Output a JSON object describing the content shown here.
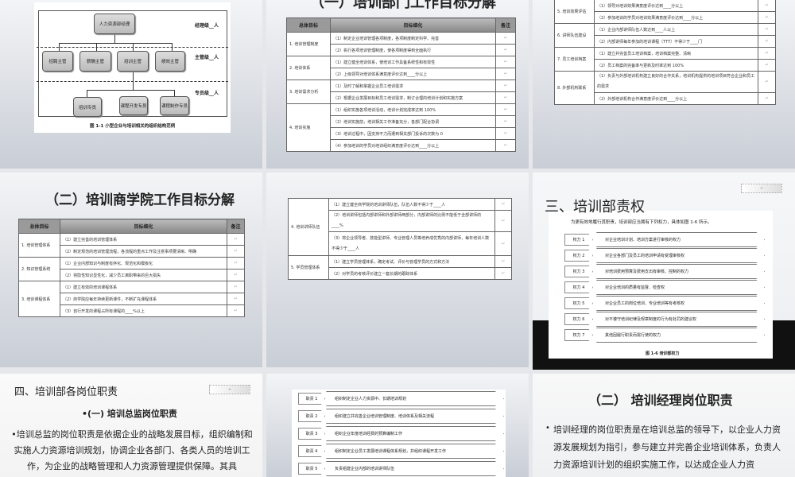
{
  "slide1": {
    "top": "人力资源部经理",
    "managers": [
      "招聘主管",
      "薪酬主管",
      "培训主管",
      "绩效主管"
    ],
    "staff": [
      "培训专员",
      "课程开发专员",
      "课程制作专员"
    ],
    "levels": [
      "经理级__人",
      "主管级__人",
      "专员级__人"
    ],
    "caption": "图 1-1  小型企业与培训相关的组织结构范例"
  },
  "slide2": {
    "title": "（一）培训部门工作目标分解",
    "headers": [
      "总体目标",
      "目标细化",
      "备注"
    ],
    "groups": [
      {
        "goal": "1. 培训管理制度",
        "items": [
          "（1）制定企业培训管理各项制度，各项制度制定科学、完善",
          "（2）执行各项培训管理制度，使各项制度得到全面执行"
        ]
      },
      {
        "goal": "2. 培训体系",
        "items": [
          "（1）建立健全培训体系，使培训工作具备系统性和有效性",
          "（2）上级领导对培训体系满意度评价达到____分以上"
        ]
      },
      {
        "goal": "3. 培训需求分析",
        "items": [
          "（1）及时了解和掌握企业员工培训需求",
          "（2）根据企业发展目标和员工培训需求，制订合理的培训计划和实施方案"
        ]
      },
      {
        "goal": "4. 培训实施",
        "items": [
          "（1）组织实施各项培训活动，培训计划完成率达到 100%",
          "（2）培训实施前，培训相关工作准备充分，各部门配合协调",
          "（3）培训过程中，因支持不力而遭到相关部门投诉的次数为 0",
          "（4）参加培训的学员对培训组织满意度评价达到____分以上"
        ]
      }
    ]
  },
  "slide3": {
    "groups": [
      {
        "goal": "5. 培训效果评估",
        "items": [
          "（1）领导对培训效果满意度评价达到____分以上",
          "（2）参加培训的学员对培训效果满意度评价达到____分以上"
        ]
      },
      {
        "goal": "6. 讲师队伍建设",
        "items": [
          "（1）企业内部讲师队伍人数达到____人以上",
          "（2）内部讲师每年参加的培训课程（TTT）不得少于____门"
        ]
      },
      {
        "goal": "7. 员工培训档案",
        "items": [
          "（1）建立并完善员工培训档案，培训档案完整、清晰",
          "（2）员工档案的完备率与更新及时率达到 100%"
        ]
      },
      {
        "goal": "8. 外部机构联系",
        "items": [
          "（1）负责与外部培训机构建立良好的合作关系，培训机构提供的培训项目符合企业和员工的需求",
          "（2）外部培训机构合作满意度评价达到____分以上"
        ]
      }
    ]
  },
  "slide4": {
    "title": "（二）培训商学院工作目标分解",
    "headers": [
      "总体目标",
      "目标细化",
      "备注"
    ],
    "groups": [
      {
        "goal": "1. 培训管理体系",
        "items": [
          "（1）建立完善的培训管理体系",
          "（2）制定规范的培训管理流程，各流程的重点工作及注意事项要清晰、明确"
        ]
      },
      {
        "goal": "2. 知识管理系统",
        "items": [
          "（1）企业内部知识与制度有序化、规范化和模板化",
          "（2）将隐性知识显性化，减少员工离职带来的巨大损失"
        ]
      },
      {
        "goal": "3. 培训课程体系",
        "items": [
          "（1）建立有效的培训课程体系",
          "（2）商学院应每年持续更新课件，不断扩充课程体系",
          "（3）自行开发的课程占所有课程的____%以上"
        ]
      }
    ]
  },
  "slide5": {
    "groups": [
      {
        "goal": "4. 培训讲师队伍",
        "items": [
          "（1）建立健全商学院的培训讲师队伍，队伍人数不得少于____人",
          "（2）培训讲师包括内部讲师和外部讲师两部分，内部讲师的比例不能低于全部讲师的____%",
          "（3）将企业领导者、技能型讲师、专业管理人员等培养成优秀的内部讲师，每年培训人数不得少于____人"
        ]
      },
      {
        "goal": "5. 学员管理体系",
        "items": [
          "（1）建立学员管理体系，确定考试、评价与管理学员的方式和方法",
          "（2）对学员的考核评价建立一套长期的跟踪体系"
        ]
      }
    ]
  },
  "slide6": {
    "title": "三、培训部责权",
    "mini": "–",
    "intro": "为更有效地履行其职责，培训部应当拥有下列权力，具体如图 1-6 所示。",
    "rights": [
      {
        "label": "权力 1",
        "text": "对企业培训计划、培训方案进行审核的权力"
      },
      {
        "label": "权力 2",
        "text": "对企业各部门及员工的培训申请有受理审核权"
      },
      {
        "label": "权力 3",
        "text": "对培训费用预算及费用支出有审核、控制的权力"
      },
      {
        "label": "权力 4",
        "text": "对企业培训的质量有监督、检查权"
      },
      {
        "label": "权力 5",
        "text": "对企业员工的岗位培训、专业培训等有考核权"
      },
      {
        "label": "权力 6",
        "text": "对不遵守培训纪律及规章制度的行为有处罚的建议权"
      },
      {
        "label": "权力 7",
        "text": "其他因履行职责而需行使的权力"
      }
    ],
    "caption": "图 1-6  培训部权力"
  },
  "slide7": {
    "title": "四、培训部各岗位职责",
    "mini": "–",
    "subtitle": "•(一) 培训总监岗位职责",
    "body": "•培训总监的岗位职责是依据企业的战略发展目标，组织编制和实施人力资源培训规划，协调企业各部门、各类人员的培训工作，为企业的战略管理和人力资源管理提供保障。其具"
  },
  "slide8": {
    "duties": [
      {
        "label": "职责 1",
        "text": "组织制定企业人力资源中、长期培训规划"
      },
      {
        "label": "职责 2",
        "text": "组织建立并完善企业培训管理制度、培训体系及相关流程"
      },
      {
        "label": "职责 3",
        "text": "组织企业年度培训经费的预算编制工作"
      },
      {
        "label": "职责 4",
        "text": "组织制定企业员工发展培训课程体系规划，并组织课程开发工作"
      },
      {
        "label": "职责 5",
        "text": "负责组建企业内部的培训讲师队伍"
      }
    ]
  },
  "slide9": {
    "title": "（二） 培训经理岗位职责",
    "body": "培训经理的岗位职责是在培训总监的领导下，以企业人力资源发展规划为指引，参与建立并完善企业培训体系，负责人力资源培训计划的组织实施工作，以达成企业人力资"
  }
}
